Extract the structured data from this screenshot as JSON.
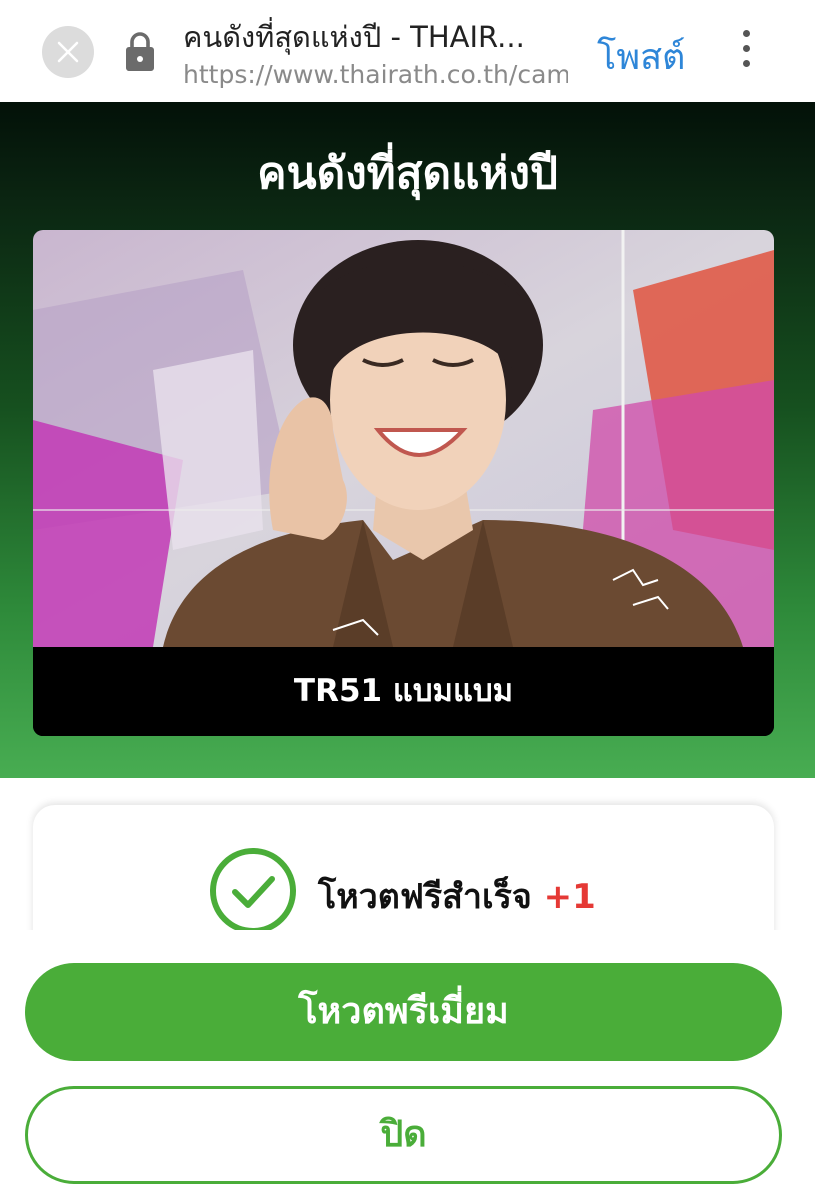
{
  "browser": {
    "title": "คนดังที่สุดแห่งปี - THAIR...",
    "url": "https://www.thairath.co.th/cam",
    "post_label": "โพสต์",
    "icons": {
      "close": "close-icon",
      "lock": "lock-icon",
      "menu": "more-vert-icon"
    }
  },
  "hero": {
    "title": "คนดังที่สุดแห่งปี",
    "candidate_caption": "TR51 แบมแบม"
  },
  "result": {
    "message": "โหวตฟรีสำเร็จ",
    "increment": "+1",
    "icon": "check-circle-icon"
  },
  "actions": {
    "premium_label": "โหวตพรีเมี่ยม",
    "close_label": "ปิด"
  },
  "colors": {
    "accent_green": "#4aad39",
    "link_blue": "#2e86d8",
    "increment_red": "#e53935"
  }
}
